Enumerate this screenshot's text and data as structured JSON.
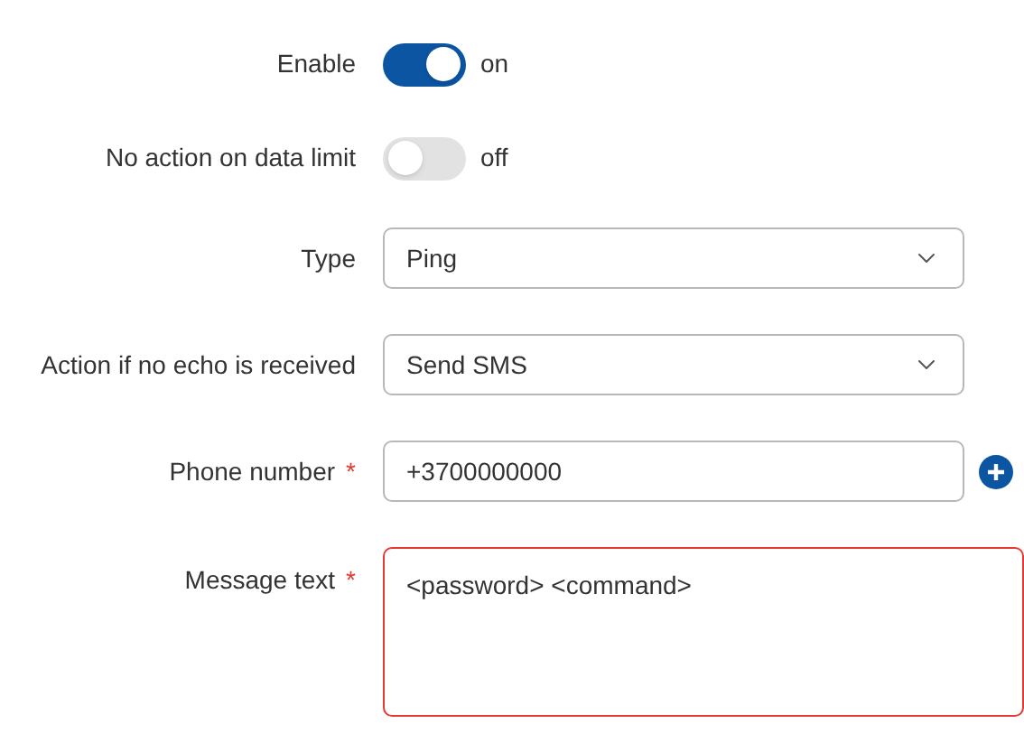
{
  "fields": [
    {
      "kind": "toggle",
      "label": "Enable",
      "on": true,
      "state_text": "on"
    },
    {
      "kind": "toggle",
      "label": "No action on data limit",
      "on": false,
      "state_text": "off"
    },
    {
      "kind": "select",
      "label": "Type",
      "value": "Ping"
    },
    {
      "kind": "select",
      "label": "Action if no echo is received",
      "value": "Send SMS"
    },
    {
      "kind": "text",
      "label": "Phone number",
      "required_mark": "*",
      "value": "+3700000000",
      "add_button": true
    },
    {
      "kind": "textarea",
      "label": "Message text",
      "required_mark": "*",
      "value": "<password> <command>",
      "invalid": true
    }
  ]
}
